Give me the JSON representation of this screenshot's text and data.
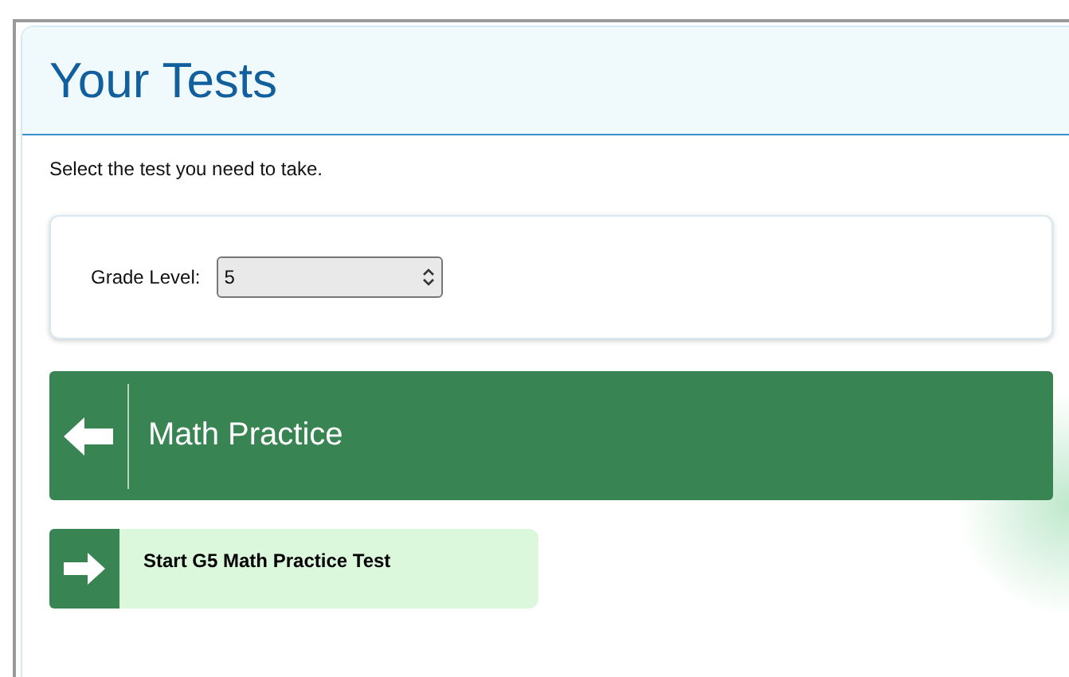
{
  "page": {
    "title": "Your Tests",
    "instructions": "Select the test you need to take."
  },
  "grade_filter": {
    "label": "Grade Level:",
    "value": "5"
  },
  "subject": {
    "title": "Math Practice"
  },
  "tests": [
    {
      "label": "Start G5 Math Practice Test"
    }
  ]
}
